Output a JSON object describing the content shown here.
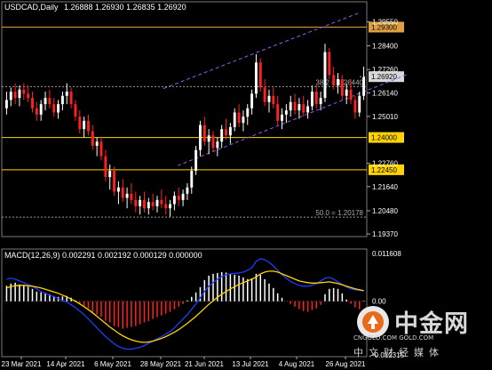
{
  "chart_data": {
    "type": "candlestick",
    "symbol": "USDCAD",
    "timeframe": "Daily",
    "title": "USDCAD,Daily",
    "ohlc_text": "1.26888 1.26930 1.26835 1.26920",
    "current_price": "1.26920",
    "price_axis": {
      "range": [
        1.1937,
        1.2996
      ],
      "ticks": [
        "1.29550",
        "1.28400",
        "1.27260",
        "1.26140",
        "1.25010",
        "1.22760",
        "1.21640",
        "1.20480",
        "1.19370"
      ]
    },
    "x_labels": [
      "23 Mar 2021",
      "14 Apr 2021",
      "6 May 2021",
      "28 May 2021",
      "21 Jun 2021",
      "13 Jul 2021",
      "4 Aug 2021",
      "26 Aug 2021"
    ],
    "horizontal_levels": [
      {
        "kind": "resistance",
        "label": "1.29300",
        "value": 1.293,
        "color": "#e0a040"
      },
      {
        "kind": "level",
        "label": "1.24000",
        "value": 1.24,
        "color": "#ffd400"
      },
      {
        "kind": "level",
        "label": "1.22450",
        "value": 1.2245,
        "color": "#ffd400"
      }
    ],
    "fibonacci": [
      {
        "label": "38.2 = 1.26440",
        "value": 1.2644
      },
      {
        "label": "50.0 = 1.20178",
        "value": 1.20178
      }
    ],
    "channel": {
      "color": "#9b59e8",
      "style": "dashed"
    },
    "candles": [
      [
        1.254,
        1.262,
        1.251,
        1.258
      ],
      [
        1.258,
        1.264,
        1.255,
        1.262
      ],
      [
        1.262,
        1.266,
        1.256,
        1.259
      ],
      [
        1.259,
        1.265,
        1.255,
        1.263
      ],
      [
        1.263,
        1.266,
        1.258,
        1.261
      ],
      [
        1.261,
        1.265,
        1.257,
        1.259
      ],
      [
        1.259,
        1.262,
        1.252,
        1.254
      ],
      [
        1.254,
        1.257,
        1.248,
        1.251
      ],
      [
        1.251,
        1.258,
        1.248,
        1.256
      ],
      [
        1.256,
        1.262,
        1.253,
        1.259
      ],
      [
        1.259,
        1.263,
        1.254,
        1.256
      ],
      [
        1.256,
        1.259,
        1.25,
        1.252
      ],
      [
        1.252,
        1.258,
        1.249,
        1.256
      ],
      [
        1.256,
        1.262,
        1.253,
        1.26
      ],
      [
        1.26,
        1.266,
        1.256,
        1.262
      ],
      [
        1.262,
        1.264,
        1.254,
        1.256
      ],
      [
        1.256,
        1.258,
        1.248,
        1.25
      ],
      [
        1.25,
        1.253,
        1.242,
        1.244
      ],
      [
        1.244,
        1.25,
        1.24,
        1.248
      ],
      [
        1.248,
        1.251,
        1.241,
        1.243
      ],
      [
        1.243,
        1.246,
        1.234,
        1.236
      ],
      [
        1.236,
        1.24,
        1.231,
        1.238
      ],
      [
        1.238,
        1.24,
        1.229,
        1.231
      ],
      [
        1.231,
        1.234,
        1.219,
        1.221
      ],
      [
        1.221,
        1.227,
        1.215,
        1.224
      ],
      [
        1.224,
        1.226,
        1.212,
        1.214
      ],
      [
        1.214,
        1.219,
        1.208,
        1.216
      ],
      [
        1.216,
        1.22,
        1.209,
        1.211
      ],
      [
        1.211,
        1.216,
        1.206,
        1.213
      ],
      [
        1.213,
        1.218,
        1.208,
        1.21
      ],
      [
        1.21,
        1.214,
        1.204,
        1.207
      ],
      [
        1.207,
        1.212,
        1.203,
        1.21
      ],
      [
        1.21,
        1.214,
        1.204,
        1.206
      ],
      [
        1.206,
        1.211,
        1.203,
        1.209
      ],
      [
        1.209,
        1.213,
        1.205,
        1.207
      ],
      [
        1.207,
        1.212,
        1.204,
        1.21
      ],
      [
        1.21,
        1.215,
        1.206,
        1.208
      ],
      [
        1.208,
        1.212,
        1.203,
        1.206
      ],
      [
        1.206,
        1.21,
        1.202,
        1.208
      ],
      [
        1.208,
        1.214,
        1.205,
        1.212
      ],
      [
        1.212,
        1.216,
        1.207,
        1.21
      ],
      [
        1.21,
        1.215,
        1.207,
        1.213
      ],
      [
        1.213,
        1.218,
        1.21,
        1.216
      ],
      [
        1.216,
        1.226,
        1.213,
        1.224
      ],
      [
        1.224,
        1.236,
        1.222,
        1.234
      ],
      [
        1.234,
        1.248,
        1.231,
        1.246
      ],
      [
        1.246,
        1.25,
        1.236,
        1.238
      ],
      [
        1.238,
        1.244,
        1.232,
        1.241
      ],
      [
        1.241,
        1.243,
        1.233,
        1.235
      ],
      [
        1.235,
        1.24,
        1.231,
        1.238
      ],
      [
        1.238,
        1.246,
        1.235,
        1.244
      ],
      [
        1.244,
        1.249,
        1.239,
        1.241
      ],
      [
        1.241,
        1.247,
        1.237,
        1.245
      ],
      [
        1.245,
        1.254,
        1.243,
        1.252
      ],
      [
        1.252,
        1.256,
        1.245,
        1.247
      ],
      [
        1.247,
        1.253,
        1.243,
        1.25
      ],
      [
        1.25,
        1.256,
        1.246,
        1.254
      ],
      [
        1.254,
        1.263,
        1.251,
        1.261
      ],
      [
        1.261,
        1.28,
        1.259,
        1.276
      ],
      [
        1.276,
        1.278,
        1.262,
        1.264
      ],
      [
        1.264,
        1.268,
        1.255,
        1.257
      ],
      [
        1.257,
        1.263,
        1.252,
        1.26
      ],
      [
        1.26,
        1.264,
        1.254,
        1.256
      ],
      [
        1.256,
        1.26,
        1.246,
        1.248
      ],
      [
        1.248,
        1.254,
        1.244,
        1.251
      ],
      [
        1.251,
        1.256,
        1.247,
        1.253
      ],
      [
        1.253,
        1.26,
        1.25,
        1.257
      ],
      [
        1.257,
        1.261,
        1.251,
        1.253
      ],
      [
        1.253,
        1.259,
        1.249,
        1.256
      ],
      [
        1.256,
        1.26,
        1.25,
        1.252
      ],
      [
        1.252,
        1.258,
        1.249,
        1.255
      ],
      [
        1.255,
        1.265,
        1.253,
        1.262
      ],
      [
        1.262,
        1.266,
        1.254,
        1.256
      ],
      [
        1.256,
        1.262,
        1.253,
        1.259
      ],
      [
        1.259,
        1.285,
        1.257,
        1.281
      ],
      [
        1.281,
        1.283,
        1.268,
        1.27
      ],
      [
        1.27,
        1.274,
        1.263,
        1.265
      ],
      [
        1.265,
        1.271,
        1.261,
        1.268
      ],
      [
        1.268,
        1.27,
        1.258,
        1.26
      ],
      [
        1.26,
        1.266,
        1.256,
        1.263
      ],
      [
        1.263,
        1.268,
        1.256,
        1.258
      ],
      [
        1.258,
        1.26,
        1.249,
        1.252
      ],
      [
        1.252,
        1.262,
        1.25,
        1.26
      ],
      [
        1.26,
        1.274,
        1.258,
        1.269
      ]
    ],
    "macd": {
      "label": "MACD(12,26,9) 0.002291 0.002192 0.000129 0.000000",
      "params": "12,26,9",
      "values": {
        "macd": 0.002291,
        "signal": 0.002192,
        "histogram": 0.000129,
        "extra": 0.0
      },
      "axis_ticks": [
        "0.011608",
        "0.00",
        "-0.012315"
      ],
      "range": [
        -0.012315,
        0.011608
      ],
      "histogram": [
        0.0035,
        0.004,
        0.0042,
        0.0038,
        0.0036,
        0.0033,
        0.0028,
        0.0022,
        0.002,
        0.0019,
        0.0016,
        0.0012,
        0.001,
        0.0011,
        0.0012,
        0.0008,
        0.0002,
        -0.0006,
        -0.001,
        -0.0016,
        -0.0024,
        -0.003,
        -0.0035,
        -0.0044,
        -0.0048,
        -0.0056,
        -0.0058,
        -0.0062,
        -0.006,
        -0.0058,
        -0.0056,
        -0.0052,
        -0.0048,
        -0.0045,
        -0.004,
        -0.0036,
        -0.0032,
        -0.0028,
        -0.0024,
        -0.0018,
        -0.0012,
        -0.0006,
        0.0002,
        0.001,
        0.002,
        0.0032,
        0.0048,
        0.0058,
        0.0062,
        0.0064,
        0.0066,
        0.0065,
        0.0062,
        0.006,
        0.0058,
        0.0054,
        0.005,
        0.0052,
        0.0062,
        0.006,
        0.005,
        0.004,
        0.003,
        0.0018,
        0.0008,
        0.0,
        -0.0006,
        -0.0012,
        -0.0018,
        -0.0022,
        -0.0024,
        -0.002,
        -0.0016,
        -0.0008,
        0.0016,
        0.0028,
        0.003,
        0.0028,
        0.0018,
        0.0004,
        -0.0006,
        -0.0014,
        -0.0018,
        0.0001
      ],
      "macd_line": [
        0.005,
        0.0052,
        0.005,
        0.0046,
        0.0042,
        0.0038,
        0.0034,
        0.0028,
        0.0022,
        0.0018,
        0.0014,
        0.001,
        0.0006,
        0.0002,
        -0.0002,
        -0.0008,
        -0.0014,
        -0.0022,
        -0.003,
        -0.004,
        -0.005,
        -0.006,
        -0.007,
        -0.008,
        -0.0088,
        -0.0096,
        -0.0102,
        -0.0106,
        -0.0108,
        -0.0108,
        -0.0106,
        -0.0104,
        -0.01,
        -0.0095,
        -0.009,
        -0.0085,
        -0.008,
        -0.0074,
        -0.0068,
        -0.006,
        -0.005,
        -0.004,
        -0.003,
        -0.0018,
        -0.0006,
        0.0008,
        0.0022,
        0.0034,
        0.0042,
        0.005,
        0.0056,
        0.006,
        0.0062,
        0.0063,
        0.0064,
        0.0066,
        0.007,
        0.0076,
        0.009,
        0.0096,
        0.0094,
        0.0088,
        0.008,
        0.007,
        0.006,
        0.0052,
        0.0045,
        0.004,
        0.0036,
        0.0034,
        0.0034,
        0.0036,
        0.004,
        0.0046,
        0.0052,
        0.0054,
        0.005,
        0.0044,
        0.0038,
        0.0032,
        0.0028,
        0.0026,
        0.0025,
        0.0023
      ],
      "signal_line": [
        0.003,
        0.0033,
        0.0035,
        0.0036,
        0.0036,
        0.0035,
        0.0034,
        0.0032,
        0.003,
        0.0027,
        0.0024,
        0.0021,
        0.0018,
        0.0014,
        0.001,
        0.0005,
        0.0,
        -0.0006,
        -0.0012,
        -0.0019,
        -0.0026,
        -0.0034,
        -0.0042,
        -0.005,
        -0.0058,
        -0.0065,
        -0.0072,
        -0.0078,
        -0.0083,
        -0.0087,
        -0.009,
        -0.0092,
        -0.0093,
        -0.0092,
        -0.009,
        -0.0087,
        -0.0084,
        -0.008,
        -0.0075,
        -0.007,
        -0.0064,
        -0.0057,
        -0.005,
        -0.0042,
        -0.0034,
        -0.0025,
        -0.0016,
        -0.0007,
        0.0001,
        0.0009,
        0.0016,
        0.0022,
        0.0028,
        0.0033,
        0.0038,
        0.0042,
        0.0046,
        0.005,
        0.0055,
        0.0062,
        0.0066,
        0.0068,
        0.0068,
        0.0066,
        0.0062,
        0.0058,
        0.0054,
        0.005,
        0.0046,
        0.0044,
        0.0042,
        0.0041,
        0.0041,
        0.0042,
        0.0043,
        0.0044,
        0.0042,
        0.004,
        0.0037,
        0.0034,
        0.0031,
        0.0028,
        0.0026,
        0.0024
      ]
    },
    "colors": {
      "bull": "#ffffff",
      "bear": "#ff2020",
      "grid": "#5a5a5a",
      "macd_line": "#1f3cff",
      "signal_line": "#ffd400",
      "hist_pos": "#ffffff",
      "hist_neg": "#ff2020"
    }
  },
  "watermark": {
    "brand": "中金网",
    "site": "CNGOLD.COM  GOLD.COM",
    "slogan": "中文财经媒体"
  }
}
